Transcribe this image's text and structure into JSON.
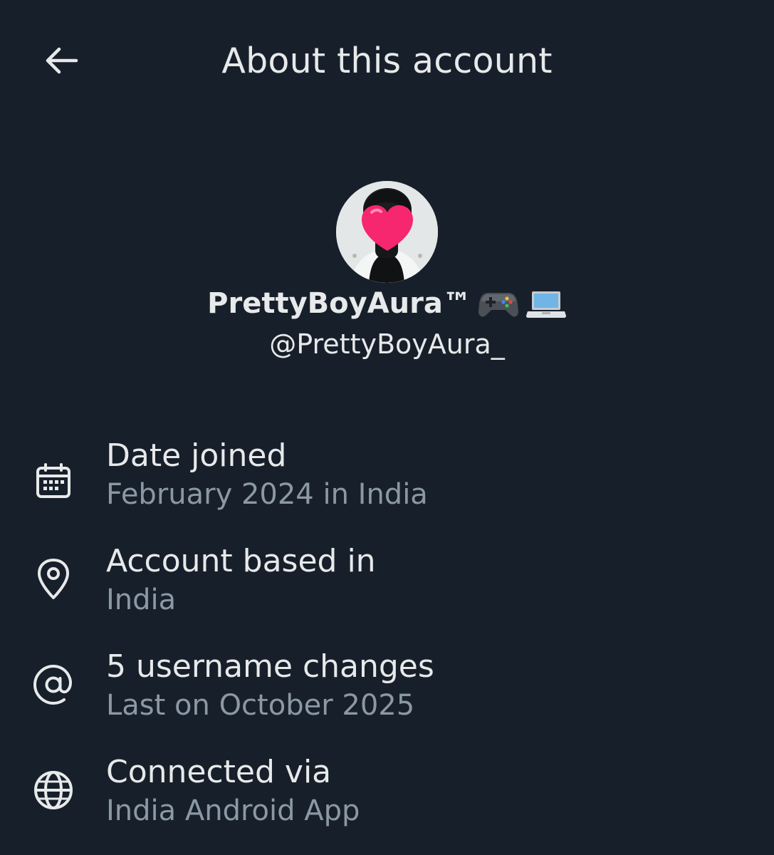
{
  "header": {
    "title": "About this account",
    "back_icon": "arrow-left-icon"
  },
  "profile": {
    "display_name": "PrettyBoyAura™",
    "display_name_emojis": [
      "game-controller-icon",
      "laptop-icon"
    ],
    "handle": "@PrettyBoyAura_",
    "avatar": "profile-avatar"
  },
  "details": [
    {
      "icon": "calendar-icon",
      "title": "Date joined",
      "subtitle": "February 2024 in India"
    },
    {
      "icon": "location-pin-icon",
      "title": "Account based in",
      "subtitle": "India"
    },
    {
      "icon": "at-sign-icon",
      "title": "5 username changes",
      "subtitle": "Last on October 2025"
    },
    {
      "icon": "globe-icon",
      "title": "Connected via",
      "subtitle": "India Android App"
    }
  ],
  "colors": {
    "background": "#17202a",
    "primary_text": "#e7e9ea",
    "secondary_text": "#8b98a5"
  }
}
